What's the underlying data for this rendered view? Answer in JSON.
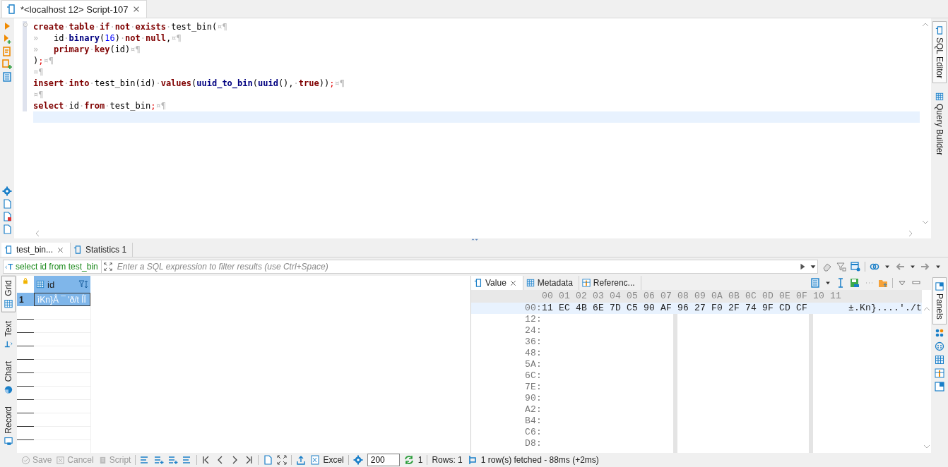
{
  "editor_tab": {
    "title": "*<localhost 12> Script-107",
    "selected": true
  },
  "code_lines": [
    {
      "current": false,
      "tokens": [
        {
          "kind": "kw",
          "text": "create"
        },
        {
          "kind": "ws",
          "text": "·"
        },
        {
          "kind": "kw",
          "text": "table"
        },
        {
          "kind": "ws",
          "text": "·"
        },
        {
          "kind": "kw",
          "text": "if"
        },
        {
          "kind": "ws",
          "text": "·"
        },
        {
          "kind": "kw",
          "text": "not"
        },
        {
          "kind": "ws",
          "text": "·"
        },
        {
          "kind": "kw",
          "text": "exists"
        },
        {
          "kind": "ws",
          "text": "·"
        },
        {
          "kind": "plain",
          "text": "test_bin("
        },
        {
          "kind": "ws",
          "text": "¤¶"
        }
      ]
    },
    {
      "current": false,
      "tokens": [
        {
          "kind": "ws",
          "text": "»   "
        },
        {
          "kind": "plain",
          "text": "id"
        },
        {
          "kind": "ws",
          "text": "·"
        },
        {
          "kind": "fn",
          "text": "binary"
        },
        {
          "kind": "plain",
          "text": "("
        },
        {
          "kind": "num",
          "text": "16"
        },
        {
          "kind": "plain",
          "text": ")"
        },
        {
          "kind": "ws",
          "text": "·"
        },
        {
          "kind": "kw",
          "text": "not"
        },
        {
          "kind": "ws",
          "text": "·"
        },
        {
          "kind": "kw",
          "text": "null"
        },
        {
          "kind": "plain",
          "text": ","
        },
        {
          "kind": "ws",
          "text": "¤¶"
        }
      ]
    },
    {
      "current": false,
      "tokens": [
        {
          "kind": "ws",
          "text": "»   "
        },
        {
          "kind": "kw",
          "text": "primary"
        },
        {
          "kind": "ws",
          "text": "·"
        },
        {
          "kind": "kw",
          "text": "key"
        },
        {
          "kind": "plain",
          "text": "(id)"
        },
        {
          "kind": "ws",
          "text": "¤¶"
        }
      ]
    },
    {
      "current": false,
      "tokens": [
        {
          "kind": "plain",
          "text": ")"
        },
        {
          "kind": "delim",
          "text": ";"
        },
        {
          "kind": "ws",
          "text": "¤¶"
        }
      ]
    },
    {
      "current": false,
      "tokens": [
        {
          "kind": "ws",
          "text": "¤¶"
        }
      ]
    },
    {
      "current": false,
      "tokens": [
        {
          "kind": "kw",
          "text": "insert"
        },
        {
          "kind": "ws",
          "text": "·"
        },
        {
          "kind": "kw",
          "text": "into"
        },
        {
          "kind": "ws",
          "text": "·"
        },
        {
          "kind": "plain",
          "text": "test_bin(id)"
        },
        {
          "kind": "ws",
          "text": "·"
        },
        {
          "kind": "kw",
          "text": "values"
        },
        {
          "kind": "plain",
          "text": "("
        },
        {
          "kind": "fn",
          "text": "uuid_to_bin"
        },
        {
          "kind": "plain",
          "text": "("
        },
        {
          "kind": "fn",
          "text": "uuid"
        },
        {
          "kind": "plain",
          "text": "(),"
        },
        {
          "kind": "ws",
          "text": "·"
        },
        {
          "kind": "kw",
          "text": "true"
        },
        {
          "kind": "plain",
          "text": "))"
        },
        {
          "kind": "delim",
          "text": ";"
        },
        {
          "kind": "ws",
          "text": "¤¶"
        }
      ]
    },
    {
      "current": false,
      "tokens": [
        {
          "kind": "ws",
          "text": "¤¶"
        }
      ]
    },
    {
      "current": false,
      "tokens": [
        {
          "kind": "kw",
          "text": "select"
        },
        {
          "kind": "ws",
          "text": "·"
        },
        {
          "kind": "plain",
          "text": "id"
        },
        {
          "kind": "ws",
          "text": "·"
        },
        {
          "kind": "kw",
          "text": "from"
        },
        {
          "kind": "ws",
          "text": "·"
        },
        {
          "kind": "plain",
          "text": "test_bin"
        },
        {
          "kind": "delim",
          "text": ";"
        },
        {
          "kind": "ws",
          "text": "¤¶"
        }
      ]
    },
    {
      "current": true
    }
  ],
  "side_tabs": [
    {
      "label": "SQL Editor",
      "selected": true
    },
    {
      "label": "Query Builder",
      "selected": false
    }
  ],
  "result_tabs": [
    {
      "label": "test_bin...",
      "selected": true,
      "closable": true
    },
    {
      "label": "Statistics 1",
      "selected": false,
      "closable": false
    }
  ],
  "filter": {
    "query": "select id from test_bin",
    "placeholder": "Enter a SQL expression to filter results (use Ctrl+Space)"
  },
  "view_tabs": [
    {
      "label": "Grid",
      "selected": true
    },
    {
      "label": "Text",
      "selected": false
    },
    {
      "label": "Chart",
      "selected": false
    },
    {
      "label": "Record",
      "selected": false
    }
  ],
  "grid": {
    "columns": [
      "id"
    ],
    "rows": [
      {
        "number": "1",
        "cells": [
          "ìKn}Å ¯ 'ð/t ÍÏ"
        ],
        "selected": true
      }
    ]
  },
  "value_tabs": [
    {
      "label": "Value",
      "selected": true,
      "closable": true
    },
    {
      "label": "Metadata",
      "selected": false,
      "closable": false
    },
    {
      "label": "Referenc...",
      "selected": false,
      "closable": false
    }
  ],
  "hex": {
    "header": "00 01 02 03 04 05 06 07 08 09 0A 0B 0C 0D 0E 0F 10 11",
    "rows": [
      {
        "offset": "00:",
        "bytes_1": "11 EC 4B 6E 7D C5 90 AF",
        "bytes_2": "96 27 F0 2F 74 9F CD CF",
        "ascii": "±.Kn}....'./t",
        "selected": true
      },
      {
        "offset": "12:",
        "selected": false
      },
      {
        "offset": "24:",
        "selected": false
      },
      {
        "offset": "36:",
        "selected": false
      },
      {
        "offset": "48:",
        "selected": false
      },
      {
        "offset": "5A:",
        "selected": false
      },
      {
        "offset": "6C:",
        "selected": false
      },
      {
        "offset": "7E:",
        "selected": false
      },
      {
        "offset": "90:",
        "selected": false
      },
      {
        "offset": "A2:",
        "selected": false
      },
      {
        "offset": "B4:",
        "selected": false
      },
      {
        "offset": "C6:",
        "selected": false
      },
      {
        "offset": "D8:",
        "selected": false
      }
    ]
  },
  "panels_tab": {
    "label": "Panels",
    "selected": true
  },
  "status_bar": {
    "actions": [
      {
        "label": "Save",
        "disabled": true
      },
      {
        "label": "Cancel",
        "disabled": true
      },
      {
        "label": "Script",
        "disabled": true
      }
    ],
    "export": "Excel",
    "fetch_size": "200",
    "refresh_count": "1",
    "rows": "Rows: 1",
    "message": "1 row(s) fetched - 88ms (+2ms)"
  }
}
